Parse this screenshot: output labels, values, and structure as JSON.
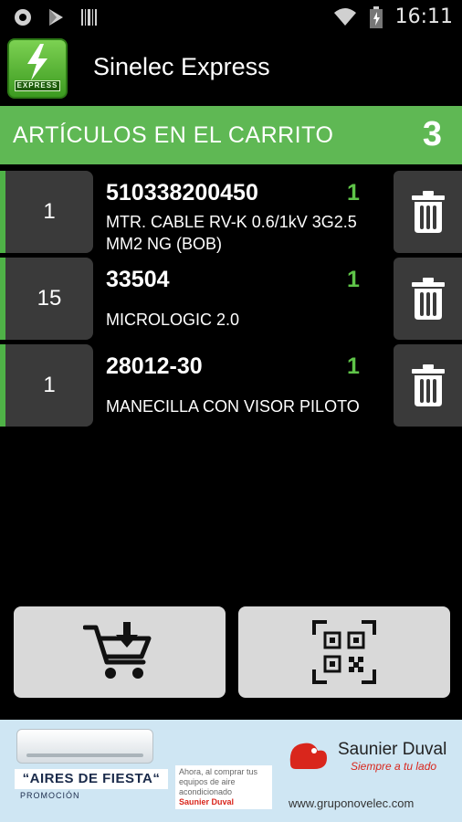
{
  "status_bar": {
    "time": "16:11",
    "left_icons": [
      "circle-notification-icon",
      "play-store-icon",
      "barcode-notification-icon"
    ],
    "right_icons": [
      "wifi-icon",
      "battery-icon"
    ]
  },
  "app_bar": {
    "title": "Sinelec Express",
    "logo_badge": "EXPRESS"
  },
  "cart": {
    "header_label": "ARTÍCULOS EN EL CARRITO",
    "count": "3",
    "items": [
      {
        "qty": "1",
        "code": "510338200450",
        "units": "1",
        "description": "MTR. CABLE RV-K 0.6/1kV 3G2.5 MM2 NG (BOB)"
      },
      {
        "qty": "15",
        "code": "33504",
        "units": "1",
        "description": "MICROLOGIC 2.0"
      },
      {
        "qty": "1",
        "code": "28012-30",
        "units": "1",
        "description": "MANECILLA CON VISOR PILOTO"
      }
    ]
  },
  "actions": {
    "add_to_cart_icon": "cart-download-icon",
    "scan_icon": "qr-scan-icon"
  },
  "banner": {
    "promo_title": "“AIRES DE FIESTA“",
    "promo_sub": "PROMOCIÓN",
    "promo_text": "Ahora, al comprar tus equipos de aire acondicionado",
    "promo_brand": "Saunier Duval",
    "brand_name": "Saunier Duval",
    "brand_tagline": "Siempre a tu lado",
    "website": "www.gruponovelec.com"
  },
  "colors": {
    "accent_green": "#5fb854",
    "units_green": "#5fc449",
    "item_bg": "#3a3a3a",
    "button_bg": "#d9d9d9"
  }
}
